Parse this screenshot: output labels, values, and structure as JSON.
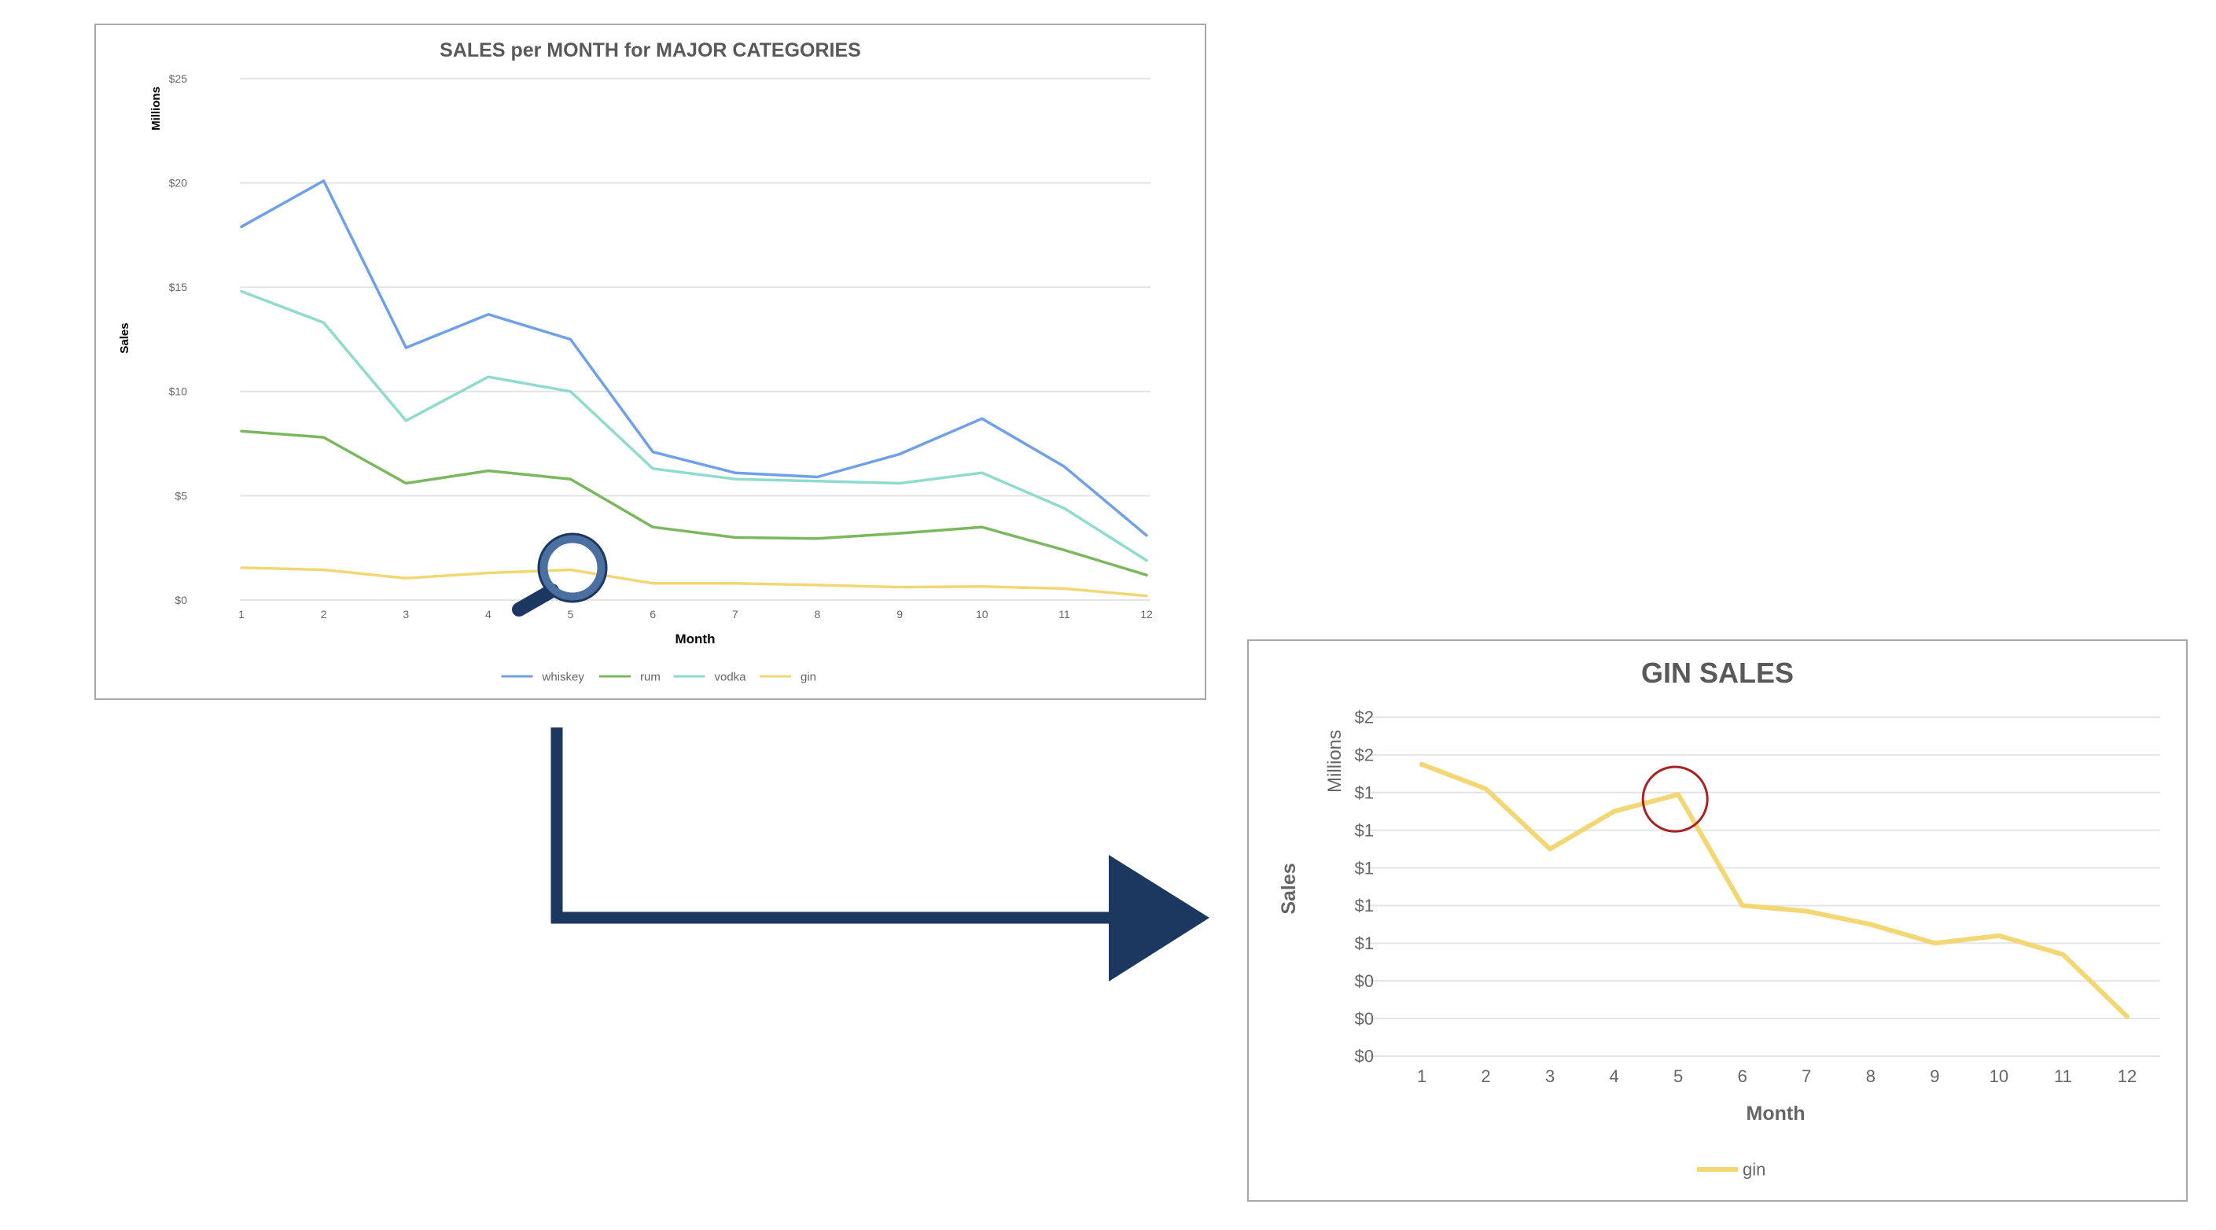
{
  "colors": {
    "whiskey": "#6fa0e8",
    "rum": "#7ab85e",
    "vodka": "#8fdccc",
    "gin": "#f2d774",
    "arrow": "#1c3861",
    "highlight_circle": "#a82323",
    "magnifier_ring": "#4b6fa0",
    "magnifier_handle": "#1c3861"
  },
  "icons": {
    "magnifier": "magnifying-glass-icon",
    "arrow": "right-angle-arrow-icon",
    "highlight": "red-circle-highlight-icon"
  },
  "chart_data": [
    {
      "type": "line",
      "title": "SALES per MONTH for MAJOR CATEGORIES",
      "xlabel": "Month",
      "ylabel": "Sales",
      "yunit_label": "Millions",
      "x": [
        1,
        2,
        3,
        4,
        5,
        6,
        7,
        8,
        9,
        10,
        11,
        12
      ],
      "x_tick_labels": [
        "1",
        "2",
        "3",
        "4",
        "5",
        "6",
        "7",
        "8",
        "9",
        "10",
        "11",
        "12"
      ],
      "y_tick_labels": [
        "$0",
        "$5",
        "$10",
        "$15",
        "$20",
        "$25"
      ],
      "ylim": [
        0,
        25
      ],
      "grid": true,
      "legend_position": "bottom",
      "series": [
        {
          "name": "whiskey",
          "values": [
            17.9,
            20.1,
            12.1,
            13.7,
            12.5,
            7.1,
            6.1,
            5.9,
            7.0,
            8.7,
            6.4,
            3.1
          ]
        },
        {
          "name": "rum",
          "values": [
            8.1,
            7.8,
            5.6,
            6.2,
            5.8,
            3.5,
            3.0,
            2.95,
            3.2,
            3.5,
            2.4,
            1.2
          ]
        },
        {
          "name": "vodka",
          "values": [
            14.8,
            13.3,
            8.6,
            10.7,
            10.0,
            6.3,
            5.8,
            5.7,
            5.6,
            6.1,
            4.4,
            1.9
          ]
        },
        {
          "name": "gin",
          "values": [
            1.55,
            1.45,
            1.05,
            1.3,
            1.45,
            0.8,
            0.8,
            0.72,
            0.62,
            0.65,
            0.55,
            0.2
          ]
        }
      ]
    },
    {
      "type": "line",
      "title": "GIN SALES",
      "xlabel": "Month",
      "ylabel": "Sales",
      "yunit_label": "Millions",
      "x": [
        1,
        2,
        3,
        4,
        5,
        6,
        7,
        8,
        9,
        10,
        11,
        12
      ],
      "x_tick_labels": [
        "1",
        "2",
        "3",
        "4",
        "5",
        "6",
        "7",
        "8",
        "9",
        "10",
        "11",
        "12"
      ],
      "y_tick_labels": [
        "$0",
        "$0",
        "$0",
        "$1",
        "$1",
        "$1",
        "$1",
        "$1",
        "$2",
        "$2"
      ],
      "ylim": [
        0,
        1.8
      ],
      "grid": true,
      "legend_position": "bottom",
      "highlight_month": 5,
      "series": [
        {
          "name": "gin",
          "values": [
            1.55,
            1.42,
            1.1,
            1.3,
            1.39,
            0.8,
            0.77,
            0.7,
            0.6,
            0.64,
            0.54,
            0.21
          ]
        }
      ]
    }
  ]
}
